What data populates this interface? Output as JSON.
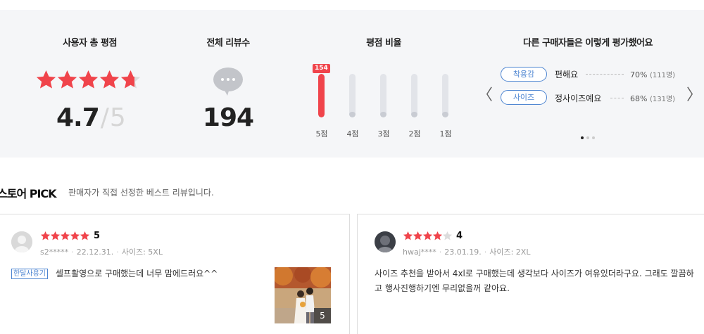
{
  "summary": {
    "rating_title": "사용자 총 평점",
    "rating_value": "4.7",
    "rating_slash": "/",
    "rating_max": "5",
    "rating_stars": 4.7,
    "count_title": "전체 리뷰수",
    "count_value": "194",
    "dist_title": "평점 비율",
    "dist_badge": "154",
    "dist": [
      {
        "label": "5점",
        "count": 154
      },
      {
        "label": "4점",
        "count": 0
      },
      {
        "label": "3점",
        "count": 0
      },
      {
        "label": "2점",
        "count": 0
      },
      {
        "label": "1점",
        "count": 0
      }
    ],
    "others_title": "다른 구매자들은 이렇게 평가했어요",
    "others": [
      {
        "chip": "착용감",
        "value": "편해요",
        "pct": "70%",
        "count": "(111명)"
      },
      {
        "chip": "사이즈",
        "value": "정사이즈예요",
        "pct": "68%",
        "count": "(131명)"
      }
    ],
    "prev_arrow": "〈",
    "next_arrow": "〉"
  },
  "pick": {
    "title": "스토어 PICK",
    "desc": "판매자가 직접 선정한 베스트 리뷰입니다."
  },
  "reviews": [
    {
      "rating": "5",
      "stars": 5,
      "user": "s2*****",
      "date": "22.12.31.",
      "size": "사이즈: 5XL",
      "tag": "한달사용기",
      "text": "셀프촬영으로 구매했는데 너무 맘에드러요^^",
      "photo_count": "5"
    },
    {
      "rating": "4",
      "stars": 4,
      "user": "hwaj****",
      "date": "23.01.19.",
      "size": "사이즈: 2XL",
      "text": "사이즈 추천을 받아서 4xl로 구매했는데 생각보다 사이즈가 여유있더라구요. 그래도 깔끔하고 행사진행하기엔 무리없을꺼 같아요."
    }
  ],
  "colors": {
    "star": "#f0444b",
    "star_empty": "#dcdcdc",
    "accent_blue": "#4d85d1",
    "panel_bg": "#f5f6f8"
  }
}
